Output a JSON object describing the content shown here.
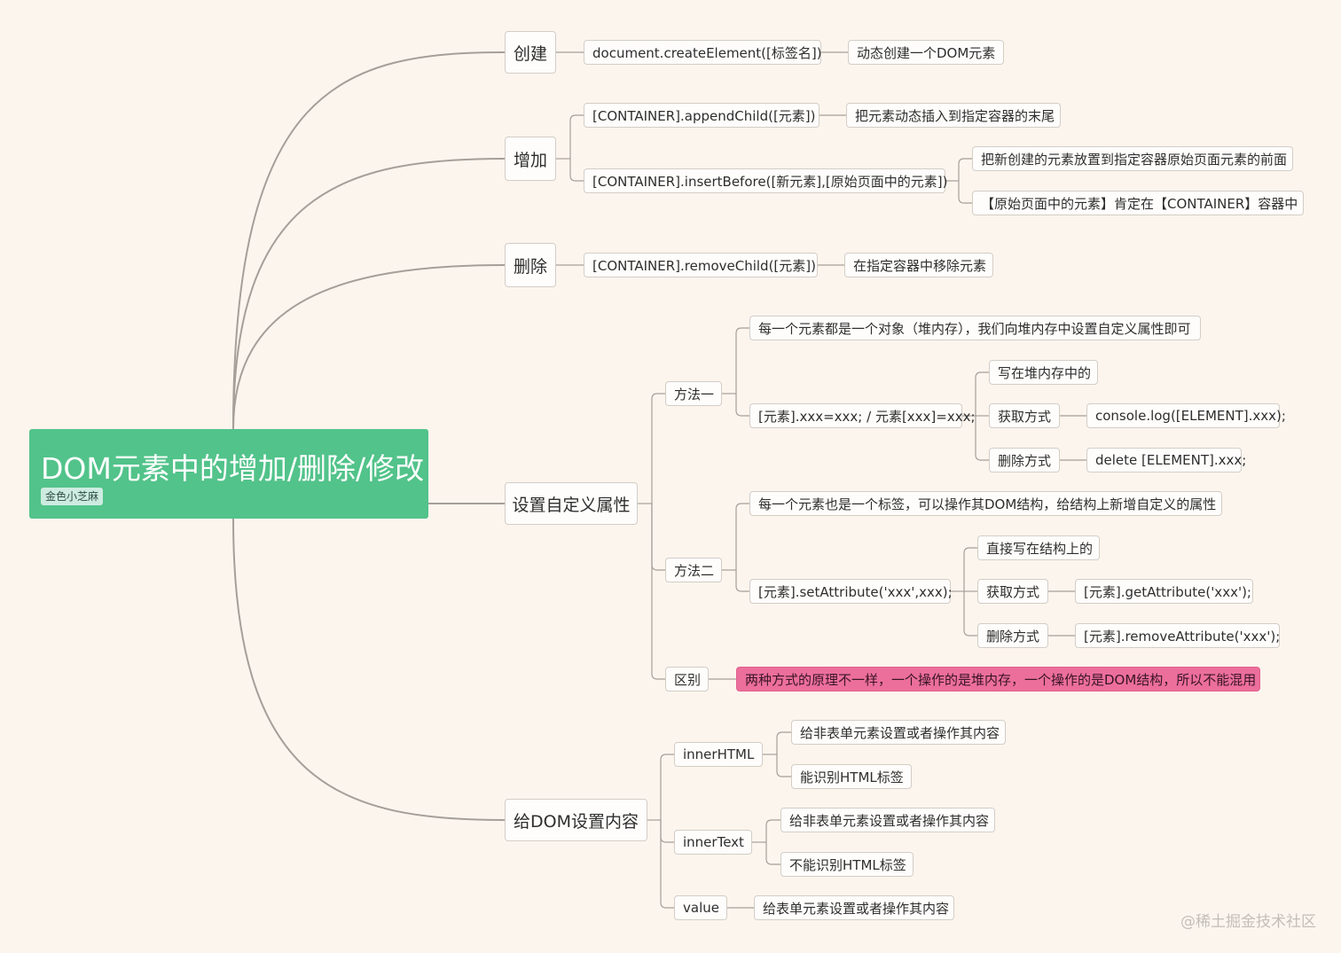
{
  "colors": {
    "background": "#fcf5ee",
    "root": "#52c38a",
    "link": "#a59f99",
    "highlight": "#ec6f9b"
  },
  "root": {
    "title": "DOM元素中的增加/删除/修改",
    "tag": "金色小芝麻"
  },
  "watermark": "@稀土掘金技术社区",
  "nodes": [
    {
      "id": "create",
      "text": "创建",
      "parent": "root"
    },
    {
      "id": "create-1",
      "text": "document.createElement([标签名])",
      "parent": "create"
    },
    {
      "id": "create-1-1",
      "text": "动态创建一个DOM元素",
      "parent": "create-1"
    },
    {
      "id": "add",
      "text": "增加",
      "parent": "root"
    },
    {
      "id": "add-1",
      "text": "[CONTAINER].appendChild([元素])",
      "parent": "add"
    },
    {
      "id": "add-1-1",
      "text": "把元素动态插入到指定容器的末尾",
      "parent": "add-1"
    },
    {
      "id": "add-2",
      "text": "[CONTAINER].insertBefore([新元素],[原始页面中的元素])",
      "parent": "add"
    },
    {
      "id": "add-2-1",
      "text": "把新创建的元素放置到指定容器原始页面元素的前面",
      "parent": "add-2"
    },
    {
      "id": "add-2-2",
      "text": "【原始页面中的元素】肯定在【CONTAINER】容器中",
      "parent": "add-2"
    },
    {
      "id": "del",
      "text": "删除",
      "parent": "root"
    },
    {
      "id": "del-1",
      "text": "[CONTAINER].removeChild([元素])",
      "parent": "del"
    },
    {
      "id": "del-1-1",
      "text": "在指定容器中移除元素",
      "parent": "del-1"
    },
    {
      "id": "attr",
      "text": "设置自定义属性",
      "parent": "root"
    },
    {
      "id": "m1",
      "text": "方法一",
      "parent": "attr"
    },
    {
      "id": "m1-a",
      "text": "每一个元素都是一个对象（堆内存），我们向堆内存中设置自定义属性即可",
      "parent": "m1"
    },
    {
      "id": "m1-b",
      "text": "[元素].xxx=xxx; / 元素[xxx]=xxx;",
      "parent": "m1"
    },
    {
      "id": "m1-b-1",
      "text": "写在堆内存中的",
      "parent": "m1-b"
    },
    {
      "id": "m1-b-2",
      "text": "获取方式",
      "parent": "m1-b"
    },
    {
      "id": "m1-b-2-1",
      "text": "console.log([ELEMENT].xxx);",
      "parent": "m1-b-2"
    },
    {
      "id": "m1-b-3",
      "text": "删除方式",
      "parent": "m1-b"
    },
    {
      "id": "m1-b-3-1",
      "text": "delete [ELEMENT].xxx;",
      "parent": "m1-b-3"
    },
    {
      "id": "m2",
      "text": "方法二",
      "parent": "attr"
    },
    {
      "id": "m2-a",
      "text": "每一个元素也是一个标签，可以操作其DOM结构，给结构上新增自定义的属性",
      "parent": "m2"
    },
    {
      "id": "m2-b",
      "text": "[元素].setAttribute('xxx',xxx);",
      "parent": "m2"
    },
    {
      "id": "m2-b-1",
      "text": "直接写在结构上的",
      "parent": "m2-b"
    },
    {
      "id": "m2-b-2",
      "text": "获取方式",
      "parent": "m2-b"
    },
    {
      "id": "m2-b-2-1",
      "text": "[元素].getAttribute('xxx');",
      "parent": "m2-b-2"
    },
    {
      "id": "m2-b-3",
      "text": "删除方式",
      "parent": "m2-b"
    },
    {
      "id": "m2-b-3-1",
      "text": "[元素].removeAttribute('xxx');",
      "parent": "m2-b-3"
    },
    {
      "id": "diff",
      "text": "区别",
      "parent": "attr"
    },
    {
      "id": "diff-1",
      "text": "两种方式的原理不一样，一个操作的是堆内存，一个操作的是DOM结构，所以不能混用",
      "parent": "diff",
      "highlight": true
    },
    {
      "id": "content",
      "text": "给DOM设置内容",
      "parent": "root"
    },
    {
      "id": "ih",
      "text": "innerHTML",
      "parent": "content"
    },
    {
      "id": "ih-1",
      "text": "给非表单元素设置或者操作其内容",
      "parent": "ih"
    },
    {
      "id": "ih-2",
      "text": "能识别HTML标签",
      "parent": "ih"
    },
    {
      "id": "it",
      "text": "innerText",
      "parent": "content"
    },
    {
      "id": "it-1",
      "text": "给非表单元素设置或者操作其内容",
      "parent": "it"
    },
    {
      "id": "it-2",
      "text": "不能识别HTML标签",
      "parent": "it"
    },
    {
      "id": "val",
      "text": "value",
      "parent": "content"
    },
    {
      "id": "val-1",
      "text": "给表单元素设置或者操作其内容",
      "parent": "val"
    }
  ]
}
